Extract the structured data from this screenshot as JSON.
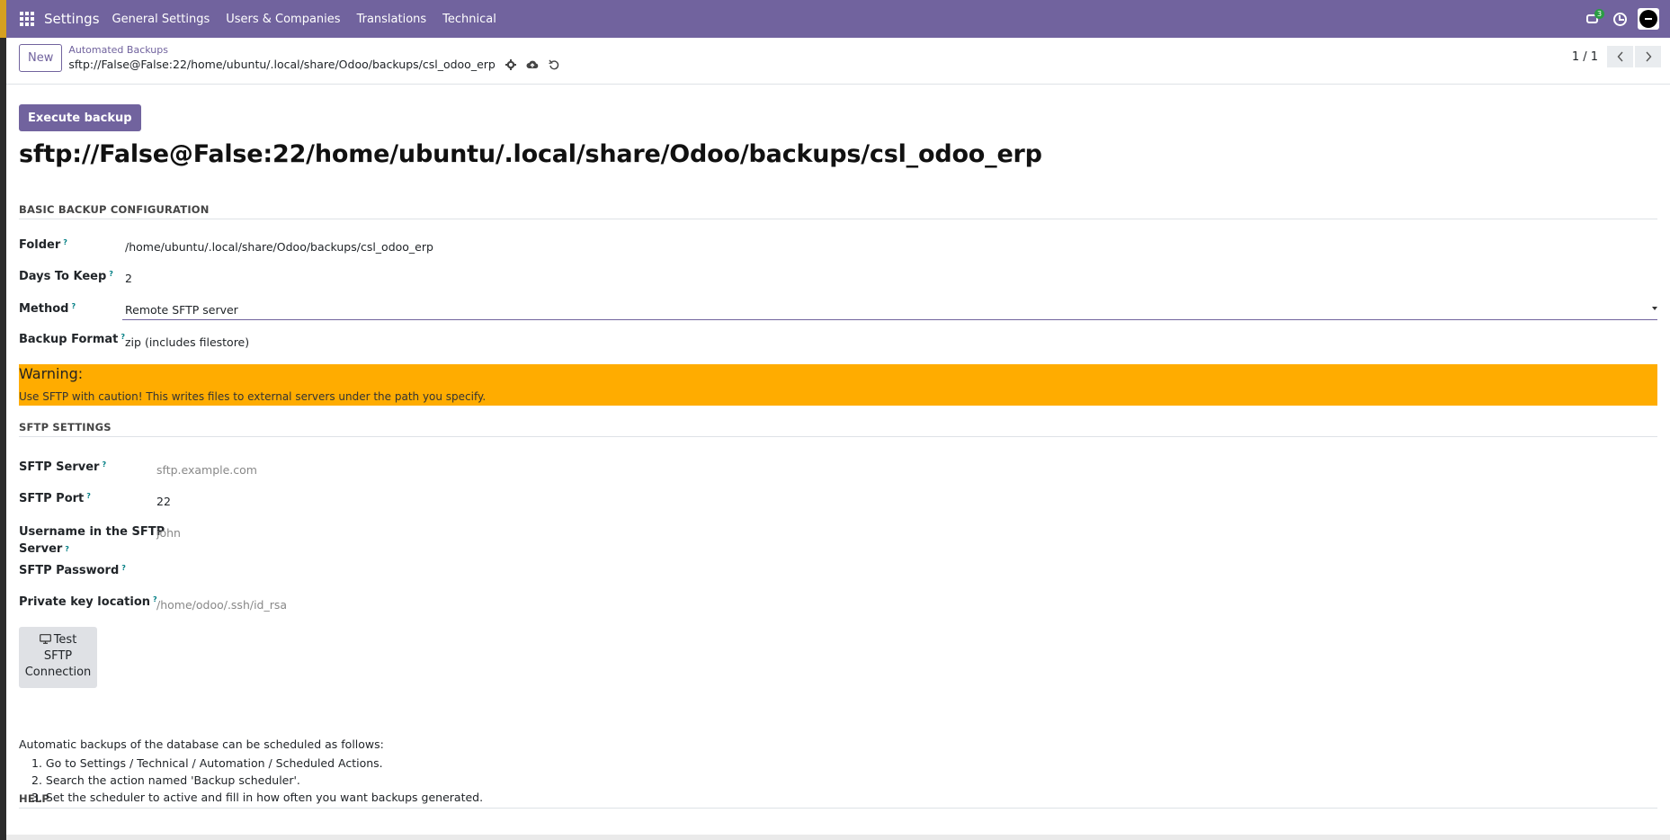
{
  "navbar": {
    "app_name": "Settings",
    "menu": [
      "General Settings",
      "Users & Companies",
      "Translations",
      "Technical"
    ],
    "messages_badge": "3"
  },
  "control_panel": {
    "new_label": "New",
    "breadcrumb_parent": "Automated Backups",
    "breadcrumb_current": "sftp://False@False:22/home/ubuntu/.local/share/Odoo/backups/csl_odoo_erp",
    "pager": "1 / 1"
  },
  "form": {
    "execute_label": "Execute backup",
    "title": "sftp://False@False:22/home/ubuntu/.local/share/Odoo/backups/csl_odoo_erp",
    "basic_section": "BASIC BACKUP CONFIGURATION",
    "folder_label": "Folder",
    "folder_value": "/home/ubuntu/.local/share/Odoo/backups/csl_odoo_erp",
    "days_label": "Days To Keep",
    "days_value": "2",
    "method_label": "Method",
    "method_value": "Remote SFTP server",
    "format_label": "Backup Format",
    "format_value": "zip (includes filestore)",
    "warning_title": "Warning:",
    "warning_text": "Use SFTP with caution! This writes files to external servers under the path you specify.",
    "sftp_section": "SFTP SETTINGS",
    "sftp_server_label": "SFTP Server",
    "sftp_server_placeholder": "sftp.example.com",
    "sftp_port_label": "SFTP Port",
    "sftp_port_value": "22",
    "username_label_1": "Username in the SFTP",
    "username_label_2": "Server",
    "username_placeholder": "john",
    "password_label": "SFTP Password",
    "key_label": "Private key location",
    "key_placeholder": "/home/odoo/.ssh/id_rsa",
    "test_label_1": "Test",
    "test_label_2": "SFTP",
    "test_label_3": "Connection",
    "help_section": "HELP",
    "help_intro": "Automatic backups of the database can be scheduled as follows:",
    "help_steps": [
      "1. Go to Settings / Technical / Automation / Scheduled Actions.",
      "2. Search the action named 'Backup scheduler'.",
      "3. Set the scheduler to active and fill in how often you want backups generated."
    ]
  }
}
